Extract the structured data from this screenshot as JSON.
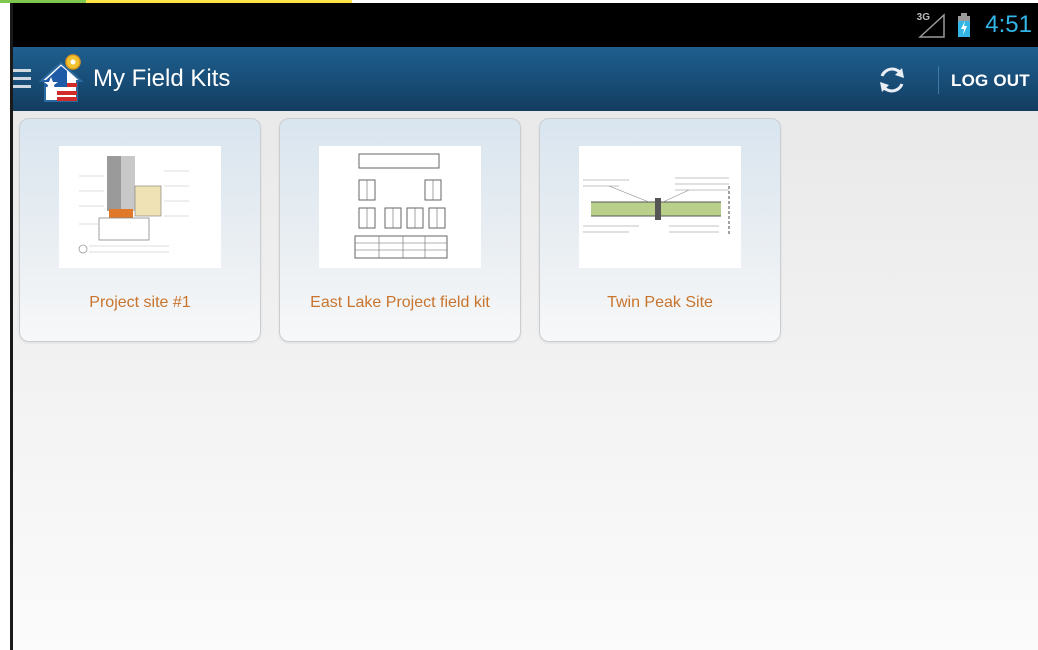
{
  "status_bar": {
    "network": "3G",
    "time": "4:51"
  },
  "action_bar": {
    "title": "My Field Kits",
    "logout_label": "LOG OUT"
  },
  "field_kits": [
    {
      "name": "Project site #1"
    },
    {
      "name": "East Lake Project field kit"
    },
    {
      "name": "Twin Peak Site"
    }
  ],
  "colors": {
    "status_bar_bg": "#000000",
    "action_bar_bg": "#174b74",
    "clock": "#33b5e5",
    "kit_label": "#c8742d"
  },
  "icons": {
    "menu": "menu-icon",
    "logo": "app-logo-icon",
    "refresh": "refresh-icon",
    "signal": "signal-icon",
    "battery": "battery-icon"
  }
}
